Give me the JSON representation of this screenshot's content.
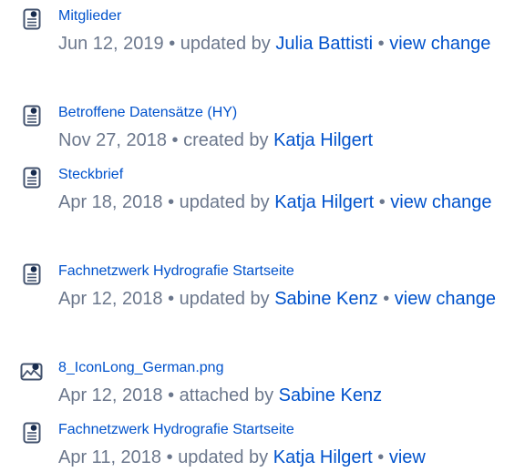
{
  "feed": {
    "entries": [
      {
        "icon": "page-icon",
        "title": "Mitglieder",
        "date": "Jun 12, 2019",
        "separator": "•",
        "action": "updated by",
        "user": "Julia Battisti",
        "view_prefix": "view",
        "view_suffix": "change"
      },
      {
        "icon": "page-icon",
        "title": "Betroffene Datensätze (HY)",
        "date": "Nov 27, 2018",
        "separator": "•",
        "action": "created by",
        "user": "Katja Hilgert"
      },
      {
        "icon": "page-icon",
        "title": "Steckbrief",
        "date": "Apr 18, 2018",
        "separator": "•",
        "action": "updated by",
        "user": "Katja Hilgert",
        "view_prefix": "view",
        "view_suffix": "change"
      },
      {
        "icon": "page-icon",
        "title": "Fachnetzwerk Hydrografie Startseite",
        "date": "Apr 12, 2018",
        "separator": "•",
        "action": "updated by",
        "user": "Sabine Kenz",
        "view_prefix": "view",
        "view_suffix": "change"
      },
      {
        "icon": "image-icon",
        "title": "8_IconLong_German.png",
        "date": "Apr 12, 2018",
        "separator": "•",
        "action": "attached by",
        "user": "Sabine Kenz"
      },
      {
        "icon": "page-icon",
        "title": "Fachnetzwerk Hydrografie Startseite",
        "date": "Apr 11, 2018",
        "separator": "•",
        "action": "updated by",
        "user": "Katja Hilgert",
        "view_prefix": "view"
      }
    ]
  },
  "colors": {
    "link": "#0052cc",
    "meta_text": "#6b778c",
    "icon_stroke": "#42526e"
  }
}
